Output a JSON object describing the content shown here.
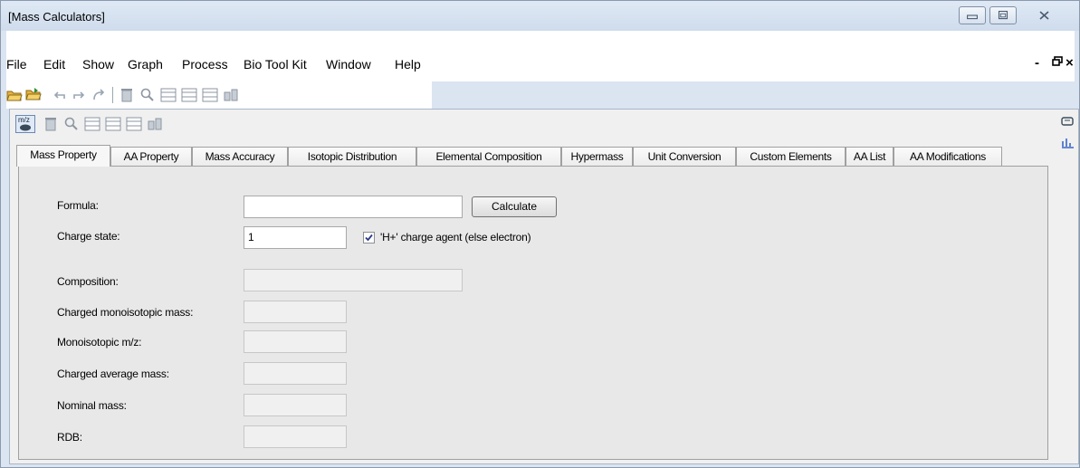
{
  "window": {
    "title": "[Mass Calculators]"
  },
  "menu": {
    "items": [
      "File",
      "Edit",
      "Show",
      "Graph",
      "Process",
      "Bio Tool Kit",
      "Window",
      "Help"
    ],
    "mdi_controls": [
      "-",
      "ə",
      "×"
    ]
  },
  "tabs": [
    {
      "label": "Mass Property",
      "active": true
    },
    {
      "label": "AA Property",
      "active": false
    },
    {
      "label": "Mass Accuracy",
      "active": false
    },
    {
      "label": "Isotopic Distribution",
      "active": false
    },
    {
      "label": "Elemental Composition",
      "active": false
    },
    {
      "label": "Hypermass",
      "active": false
    },
    {
      "label": "Unit Conversion",
      "active": false
    },
    {
      "label": "Custom Elements",
      "active": false
    },
    {
      "label": "AA List",
      "active": false
    },
    {
      "label": "AA Modifications",
      "active": false
    }
  ],
  "form": {
    "formula_label": "Formula:",
    "formula_value": "",
    "calculate_label": "Calculate",
    "charge_label": "Charge state:",
    "charge_value": "1",
    "charge_agent_label": "'H+' charge agent (else electron)",
    "charge_agent_checked": true,
    "composition_label": "Composition:",
    "charged_mono_label": "Charged monoisotopic mass:",
    "mono_mz_label": "Monoisotopic m/z:",
    "charged_avg_label": "Charged average mass:",
    "nominal_label": "Nominal mass:",
    "rdb_label": "RDB:"
  },
  "toolbar2": {
    "mz_icon_text": "m/z"
  },
  "colors": {
    "title_bg": "#dfe9f5",
    "panel_bg": "#e8e8e8",
    "tab_border": "#a0a0a0"
  }
}
